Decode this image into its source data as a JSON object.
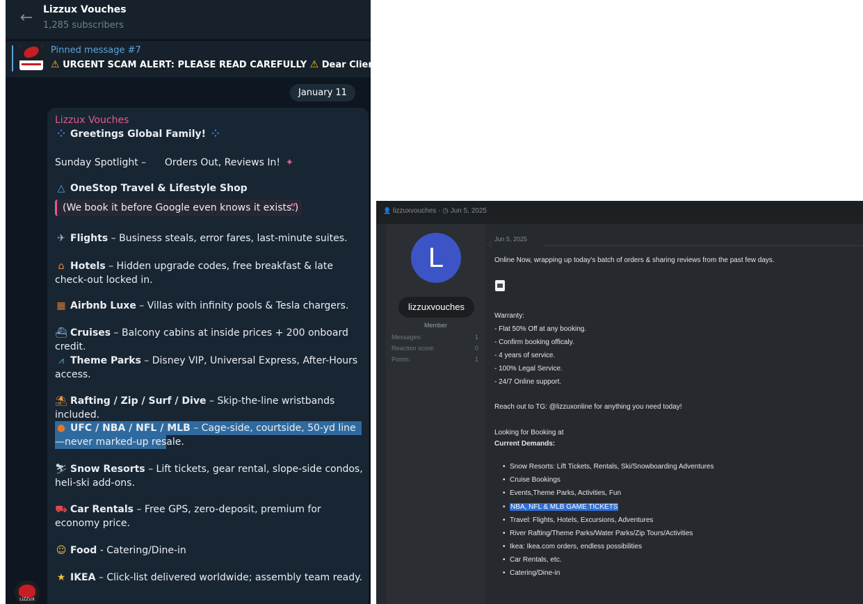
{
  "telegram": {
    "back_icon": "←",
    "channel_title": "Lizzux Vouches",
    "subscribers": "1,285 subscribers",
    "pinned": {
      "title": "Pinned message #7",
      "text": "URGENT SCAM ALERT: PLEASE READ CAREFULLY",
      "text_tail": "Dear Clients",
      "warn_icon": "⚠"
    },
    "date_divider": "January 11",
    "message": {
      "author": "Lizzux Vouches",
      "greeting": "Greetings Global Family!",
      "greeting_icon": "⁘",
      "spotlight": "Sunday Spotlight –      Orders Out, Reviews In!",
      "spotlight_icon": "✦",
      "shop_name": "OneStop Travel & Lifestyle Shop",
      "shop_icon": "△",
      "quote": "(We book it before Google even knows it exists.)",
      "quote_mark": "”",
      "features": [
        {
          "icon": "✈",
          "title": "Flights",
          "text": " – Business steals, error fares, last-minute suites."
        },
        {
          "icon": "⌂",
          "title": "Hotels",
          "text": " – Hidden upgrade codes, free breakfast & late check-out locked in."
        },
        {
          "icon": "▦",
          "title": "Airbnb Luxe",
          "text": " – Villas with infinity pools & Tesla chargers."
        },
        {
          "icon": "⛴",
          "title": "Cruises",
          "text": " – Balcony cabins at inside prices + 200 onboard credit."
        },
        {
          "icon": "⩘",
          "title": "Theme Parks",
          "text": " – Disney VIP, Universal Express, After-Hours access."
        },
        {
          "icon": "⛱",
          "title": "Rafting / Zip / Surf / Dive",
          "text": " – Skip-the-line wristbands included."
        },
        {
          "icon": "●",
          "title": "UFC / NBA / NFL / MLB",
          "text": " – Cage-side, courtside, 50-yd line—never marked-up resale."
        },
        {
          "icon": "⛷",
          "title": "Snow Resorts",
          "text": " – Lift tickets, gear rental, slope-side condos, heli-ski add-ons."
        },
        {
          "icon": "⛟",
          "title": "Car Rentals",
          "text": " – Free GPS, zero-deposit, premium for economy price."
        },
        {
          "icon": "☺",
          "title": "Food",
          "text": " - Catering/Dine-in"
        },
        {
          "icon": "★",
          "title": "IKEA",
          "text": " – Click-list delivered worldwide; assembly team ready."
        }
      ]
    },
    "avatar_label": "LIZZUX"
  },
  "forum": {
    "meta_user": "lizzuxvouches",
    "meta_date": "Jun 5, 2025",
    "meta_sep": "·",
    "user_icon": "👤",
    "clock_icon": "◷",
    "avatar_letter": "L",
    "username": "lizzuxvouches",
    "role": "Member",
    "stats": [
      {
        "label": "Messages:",
        "value": "1"
      },
      {
        "label": "Reaction score:",
        "value": "0"
      },
      {
        "label": "Points:",
        "value": "1"
      }
    ],
    "post_date": "Jun 5, 2025",
    "intro": "Online Now, wrapping up today's batch of orders & sharing reviews from the past few days.",
    "warranty_title": "Warranty:",
    "warranty": [
      "- Flat 50% Off at any booking.",
      "- Confirm booking officaly.",
      "- 4 years of service.",
      "- 100% Legal Service.",
      "- 24/7 Online support."
    ],
    "reach": "Reach out to TG: @lizzuxonline for anything you need today!",
    "looking": "Looking for Booking at",
    "current_title": "Current Demands:",
    "demands": [
      "Snow Resorts: Lift Tickets, Rentals, Ski/Snowboarding Adventures",
      "Cruise Bookings",
      "Events,Theme Parks, Activities, Fun",
      "NBA, NFL & MLB GAME TICKETS",
      "Travel: Flights, Hotels, Excursions, Adventures",
      "River Rafting/Theme Parks/Water Parks/Zip Tours/Activities",
      "Ikea: Ikea.com orders, endless possibilities",
      "Car Rentals, etc.",
      "Catering/Dine-in"
    ]
  }
}
